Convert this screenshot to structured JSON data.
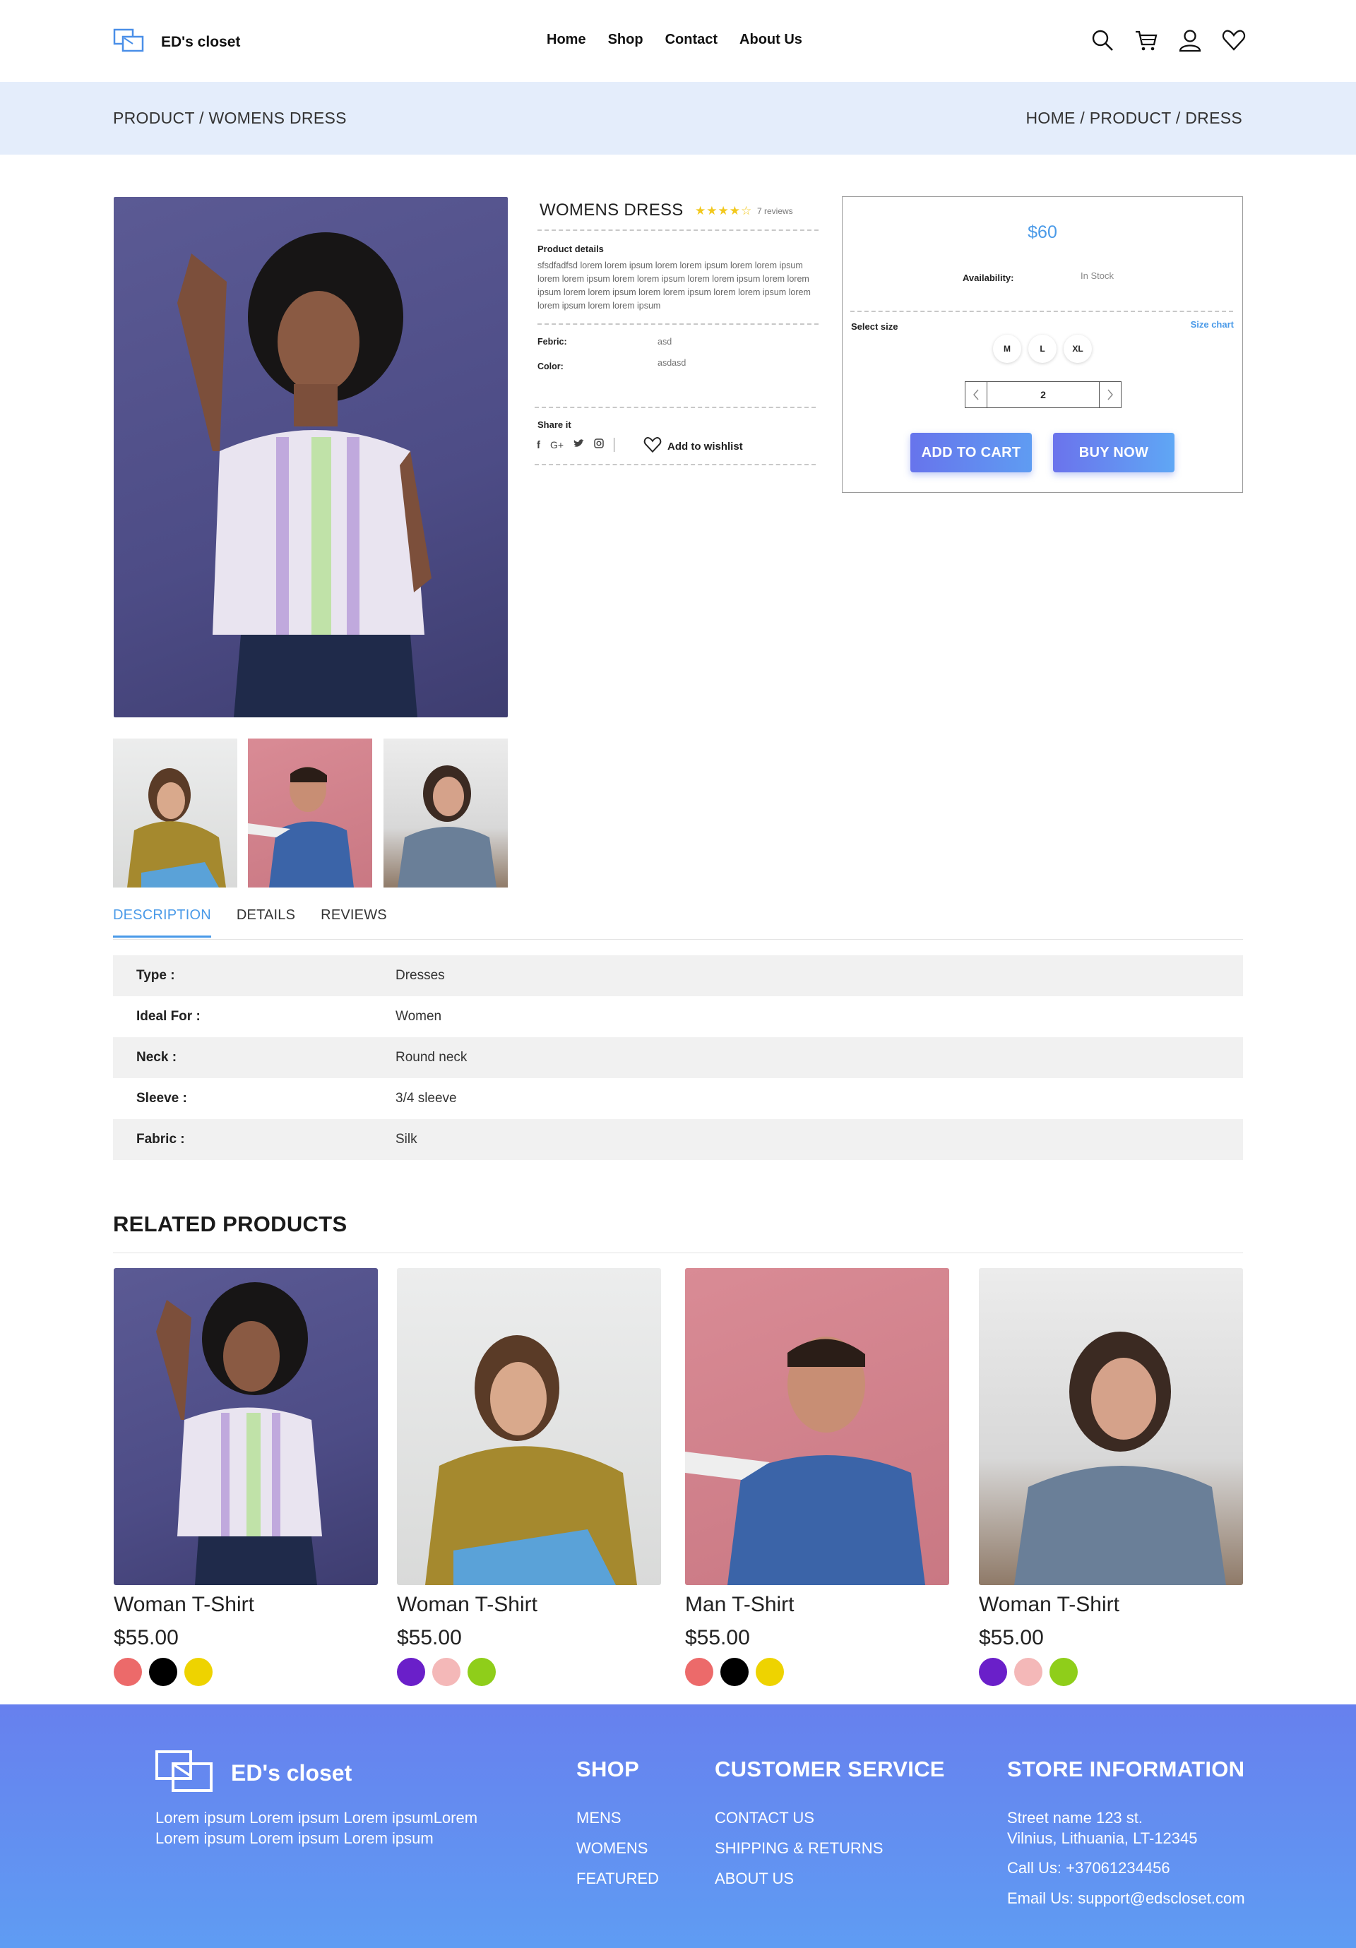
{
  "header": {
    "brand": "ED's closet",
    "nav": [
      "Home",
      "Shop",
      "Contact",
      "About Us"
    ],
    "icons": [
      "search-icon",
      "cart-icon",
      "user-icon",
      "heart-icon"
    ]
  },
  "breadcrumb": {
    "left": "PRODUCT / WOMENS DRESS",
    "right": "HOME / PRODUCT / DRESS"
  },
  "product": {
    "title": "WOMENS DRESS",
    "rating": 4,
    "stars": "★★★★☆",
    "reviews": "7 reviews",
    "details_heading": "Product details",
    "details_text": "sfsdfadfsd lorem lorem ipsum lorem lorem ipsum lorem lorem ipsum lorem lorem ipsum lorem lorem ipsum lorem lorem ipsum lorem lorem ipsum lorem lorem ipsum lorem lorem ipsum lorem lorem ipsum lorem lorem ipsum lorem lorem ipsum",
    "fabric_label": "Febric:",
    "fabric_value": "asd",
    "color_label": "Color:",
    "color_value": "asdasd",
    "share_label": "Share it",
    "wishlist_label": "Add to wishlist"
  },
  "purchase": {
    "price": "$60",
    "availability_label": "Availability:",
    "availability_value": "In Stock",
    "select_size_label": "Select size",
    "size_chart_label": "Size chart",
    "sizes": [
      "M",
      "L",
      "XL"
    ],
    "quantity": "2",
    "add_to_cart": "ADD TO CART",
    "buy_now": "BUY NOW"
  },
  "tabs": [
    "DESCRIPTION",
    "DETAILS",
    "REVIEWS"
  ],
  "specs": [
    {
      "label": "Type :",
      "value": "Dresses"
    },
    {
      "label": "Ideal For :",
      "value": "Women"
    },
    {
      "label": "Neck :",
      "value": "Round neck"
    },
    {
      "label": "Sleeve :",
      "value": "3/4 sleeve"
    },
    {
      "label": "Fabric :",
      "value": "Silk"
    }
  ],
  "related": {
    "title": "RELATED PRODUCTS",
    "items": [
      {
        "name": "Woman T-Shirt",
        "price": "$55.00",
        "colors": [
          "#ec6a6a",
          "#000000",
          "#eed300"
        ]
      },
      {
        "name": "Woman T-Shirt",
        "price": "$55.00",
        "colors": [
          "#6a1fc9",
          "#f4b8b8",
          "#8fce1a"
        ]
      },
      {
        "name": "Man T-Shirt",
        "price": "$55.00",
        "colors": [
          "#ec6a6a",
          "#000000",
          "#eed300"
        ]
      },
      {
        "name": "Woman T-Shirt",
        "price": "$55.00",
        "colors": [
          "#6a1fc9",
          "#f4b8b8",
          "#8fce1a"
        ]
      }
    ]
  },
  "footer": {
    "brand": "ED's closet",
    "about": "Lorem ipsum Lorem ipsum Lorem ipsumLorem Lorem ipsum Lorem ipsum Lorem ipsum",
    "shop_heading": "SHOP",
    "shop_links": [
      "MENS",
      "WOMENS",
      "FEATURED"
    ],
    "service_heading": "CUSTOMER SERVICE",
    "service_links": [
      "CONTACT US",
      "SHIPPING & RETURNS",
      "ABOUT US"
    ],
    "store_heading": "STORE INFORMATION",
    "address_line1": "Street name 123 st.",
    "address_line2": "Vilnius, Lithuania, LT-12345",
    "phone": "Call Us: +37061234456",
    "email": "Email Us: support@edscloset.com"
  },
  "colors": {
    "accent": "#4a9ae8",
    "button": "#6774ec",
    "breadcrumb_bg": "#e4edfb",
    "footer_bg": "#6780ee"
  }
}
